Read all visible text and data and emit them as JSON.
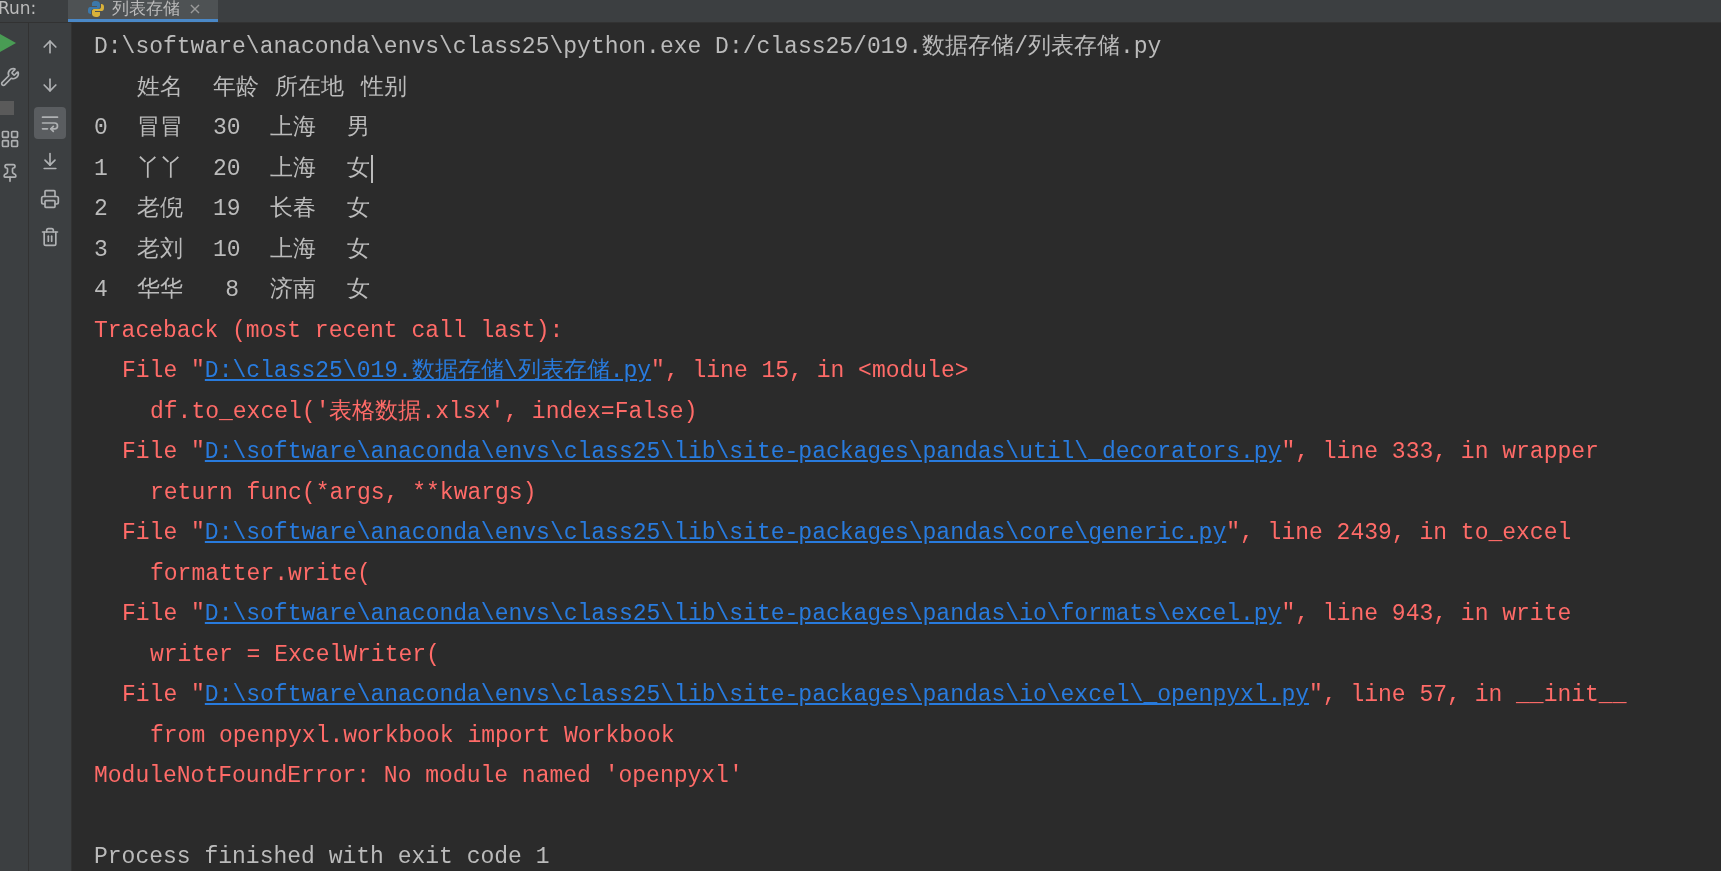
{
  "top_bar": {
    "label": "Run:",
    "tab": {
      "label": "列表存储",
      "close": "×",
      "selected": true
    }
  },
  "left_tools": [
    {
      "kind": "run"
    },
    {
      "kind": "wrench"
    },
    {
      "kind": "stop"
    },
    {
      "kind": "layout"
    },
    {
      "kind": "pin"
    }
  ],
  "console_tools": [
    {
      "kind": "up",
      "selected": false
    },
    {
      "kind": "down",
      "selected": false
    },
    {
      "kind": "wrap",
      "selected": true
    },
    {
      "kind": "scroll-end",
      "selected": false
    },
    {
      "kind": "print",
      "selected": false
    },
    {
      "kind": "trash",
      "selected": false
    }
  ],
  "console": {
    "command": "D:\\software\\anaconda\\envs\\class25\\python.exe D:/class25/019.数据存储/列表存储.py",
    "table": {
      "columns": [
        "",
        "姓名",
        "年龄",
        "所在地",
        "性别"
      ],
      "rows": [
        [
          "0",
          "冒冒",
          "30",
          "上海",
          "男"
        ],
        [
          "1",
          "丫丫",
          "20",
          "上海",
          "女"
        ],
        [
          "2",
          "老倪",
          "19",
          "长春",
          "女"
        ],
        [
          "3",
          "老刘",
          "10",
          "上海",
          "女"
        ],
        [
          "4",
          "华华",
          "8",
          "济南",
          "女"
        ]
      ]
    },
    "lines": [
      {
        "kind": "error",
        "text": "Traceback (most recent call last):"
      },
      {
        "kind": "frame",
        "prefix": "File \"",
        "link": "D:\\class25\\019.数据存储\\列表存储.py",
        "suffix": "\", line 15, in <module>"
      },
      {
        "kind": "code",
        "text": "df.to_excel('表格数据.xlsx', index=False)"
      },
      {
        "kind": "frame",
        "prefix": "File \"",
        "link": "D:\\software\\anaconda\\envs\\class25\\lib\\site-packages\\pandas\\util\\_decorators.py",
        "suffix": "\", line 333, in wrapper"
      },
      {
        "kind": "code",
        "text": "return func(*args, **kwargs)"
      },
      {
        "kind": "frame",
        "prefix": "File \"",
        "link": "D:\\software\\anaconda\\envs\\class25\\lib\\site-packages\\pandas\\core\\generic.py",
        "suffix": "\", line 2439, in to_excel"
      },
      {
        "kind": "code",
        "text": "formatter.write("
      },
      {
        "kind": "frame",
        "prefix": "File \"",
        "link": "D:\\software\\anaconda\\envs\\class25\\lib\\site-packages\\pandas\\io\\formats\\excel.py",
        "suffix": "\", line 943, in write"
      },
      {
        "kind": "code",
        "text": "writer = ExcelWriter("
      },
      {
        "kind": "frame",
        "prefix": "File \"",
        "link": "D:\\software\\anaconda\\envs\\class25\\lib\\site-packages\\pandas\\io\\excel\\_openpyxl.py",
        "suffix": "\", line 57, in __init__"
      },
      {
        "kind": "code",
        "text": "from openpyxl.workbook import Workbook"
      },
      {
        "kind": "error",
        "text": "ModuleNotFoundError: No module named 'openpyxl'"
      }
    ],
    "exit": "Process finished with exit code 1"
  }
}
